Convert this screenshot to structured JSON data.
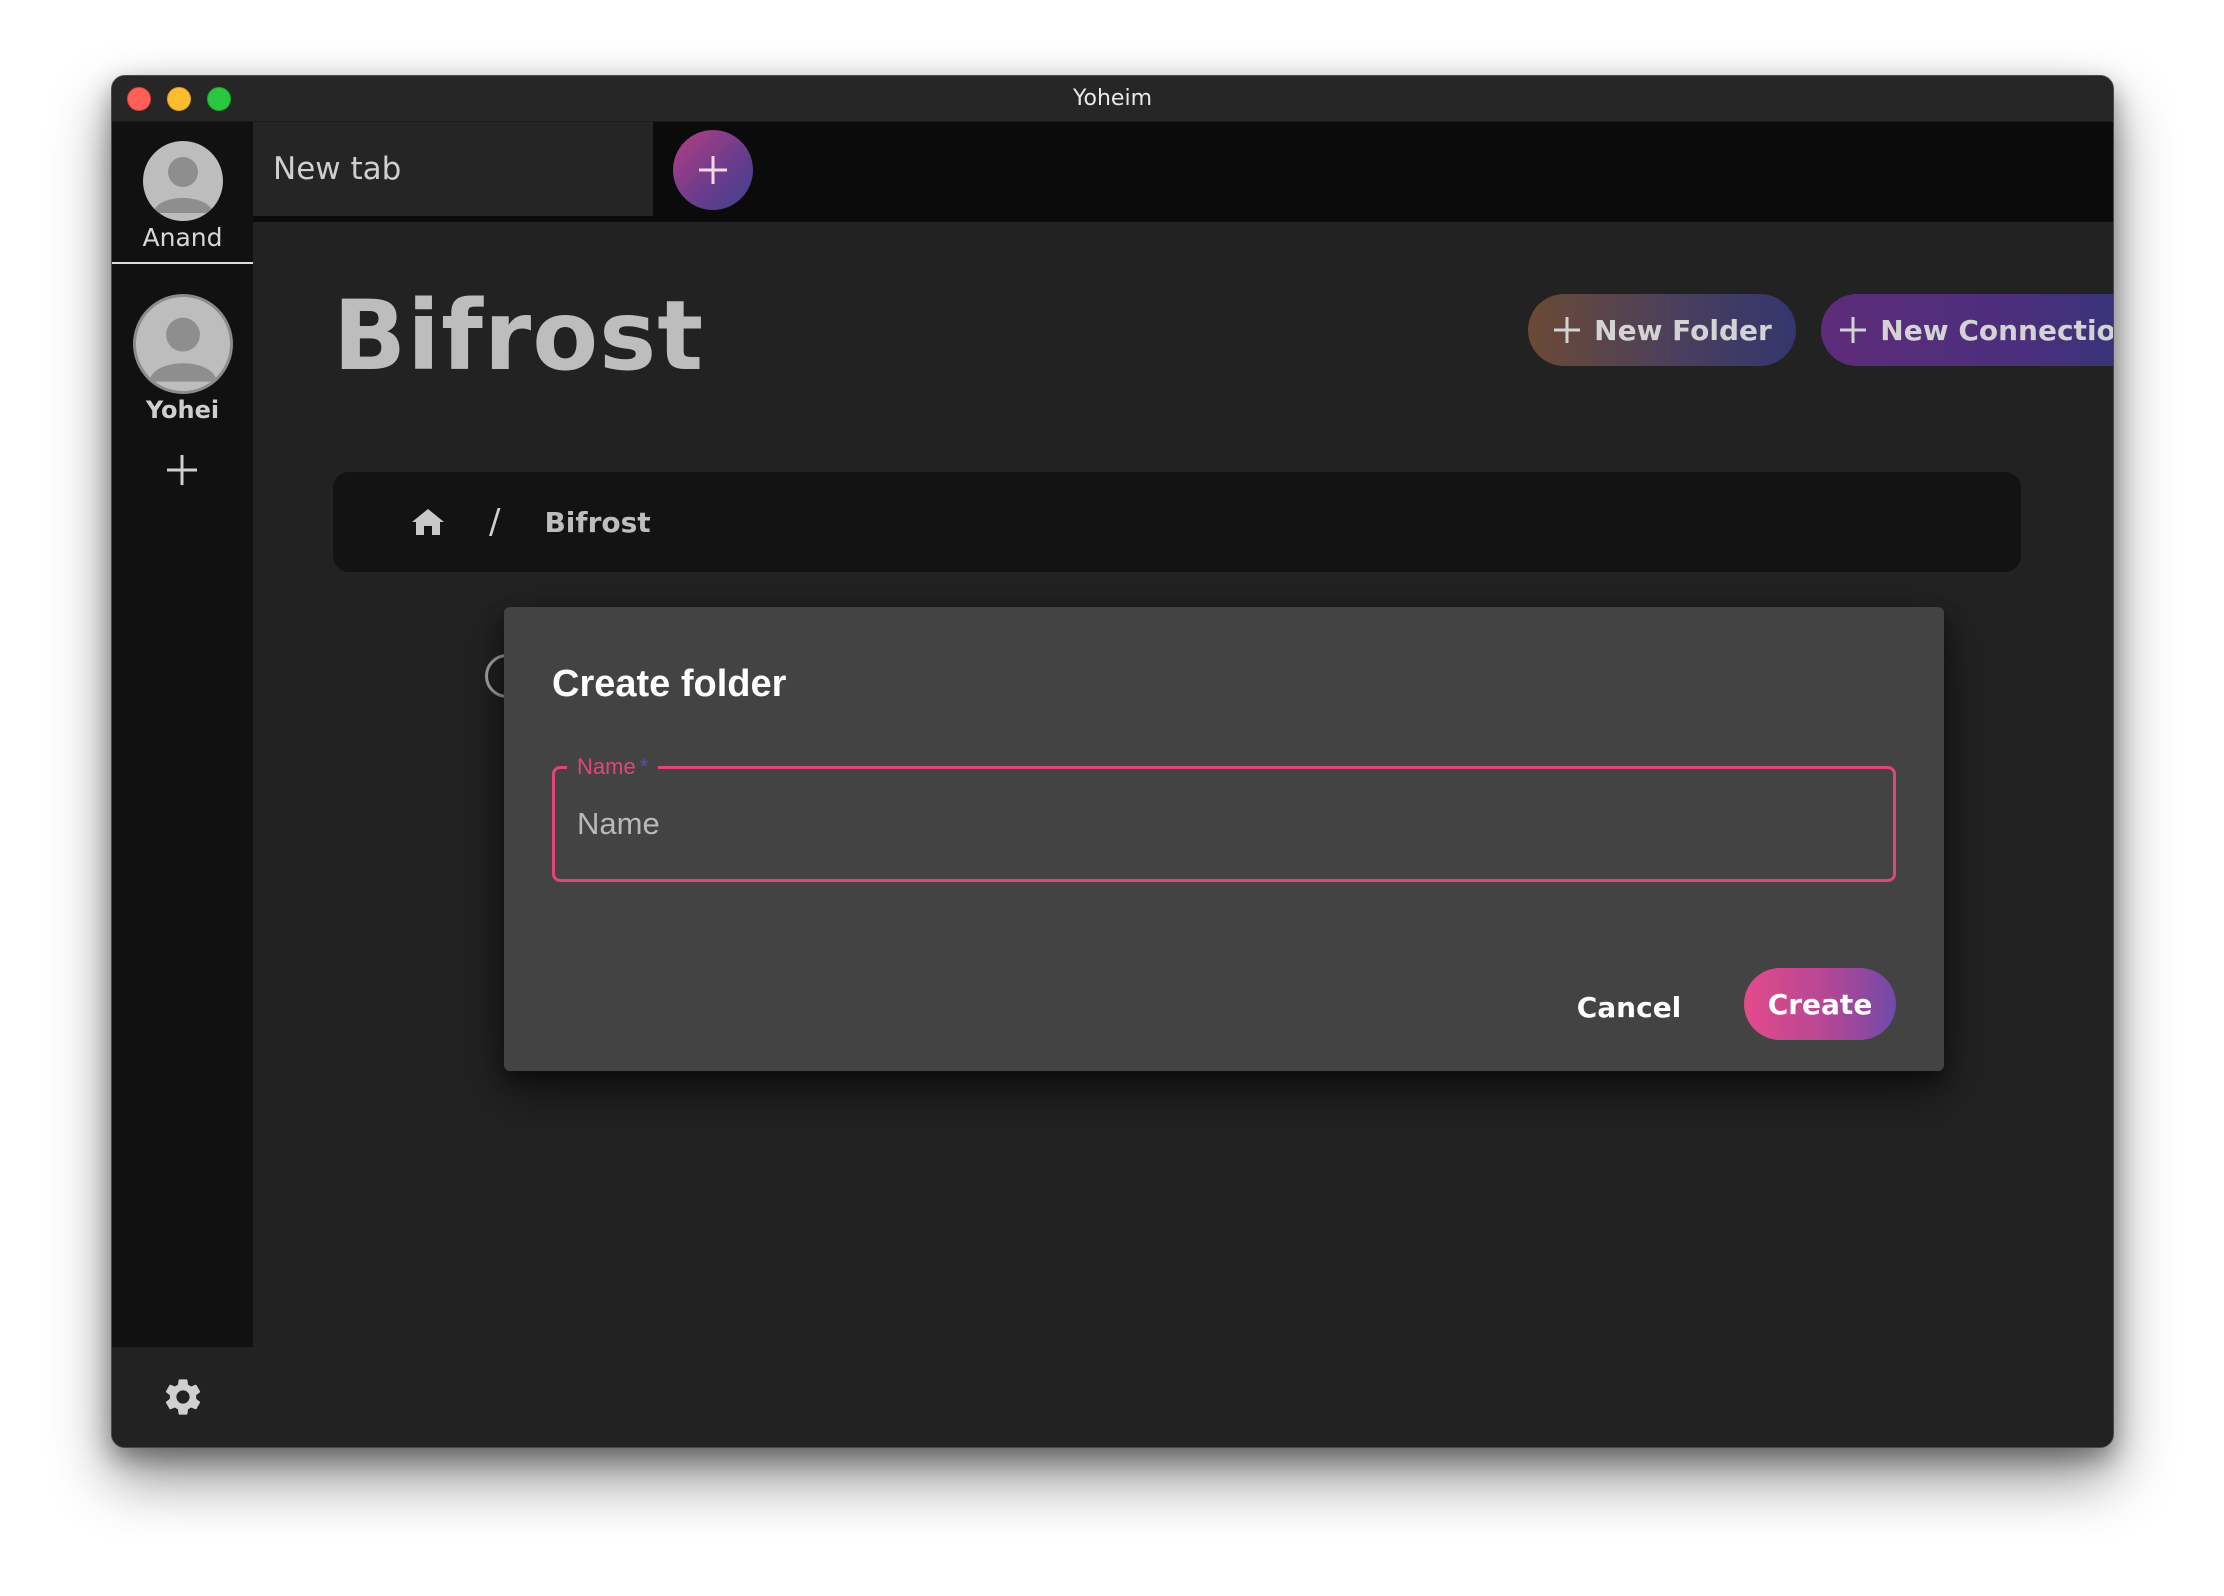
{
  "window": {
    "title": "Yoheim"
  },
  "sidebar": {
    "profiles": [
      {
        "name": "Anand",
        "avatar_icon": "user-avatar-icon"
      },
      {
        "name": "Yohei",
        "avatar_icon": "user-avatar-icon",
        "active": true
      }
    ],
    "add_profile_icon": "plus-icon",
    "settings_icon": "gear-icon"
  },
  "tabs": {
    "items": [
      {
        "label": "New tab",
        "active": true
      }
    ],
    "new_tab_icon": "plus-icon"
  },
  "main": {
    "title": "Bifrost",
    "actions": {
      "new_folder_label": "New Folder",
      "new_connection_label": "New Connection"
    },
    "breadcrumb": {
      "home_icon": "home-icon",
      "separator": "/",
      "current": "Bifrost"
    }
  },
  "dialog": {
    "title": "Create folder",
    "name_field": {
      "label": "Name",
      "required_mark": "*",
      "placeholder": "Name",
      "value": ""
    },
    "cancel_label": "Cancel",
    "create_label": "Create"
  },
  "colors": {
    "accent_pink": "#e0457d",
    "window_bg": "#222222",
    "dialog_bg": "#434343",
    "sidebar_bg": "#111111"
  }
}
